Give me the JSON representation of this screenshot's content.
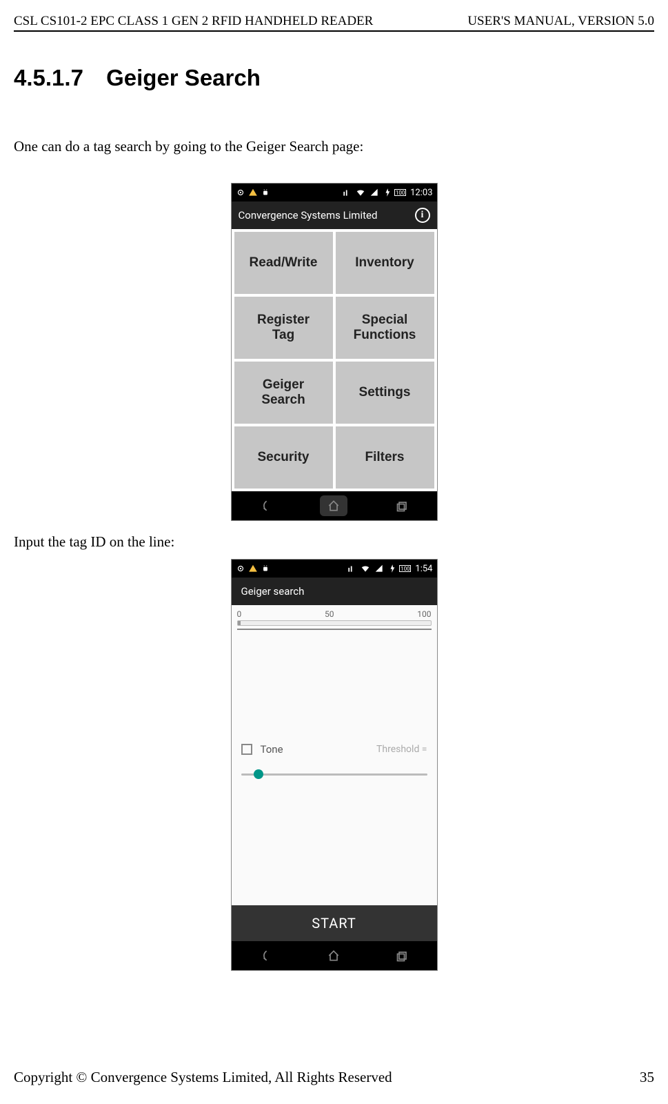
{
  "header": {
    "left": "CSL CS101-2 EPC CLASS 1 GEN 2 RFID HANDHELD READER",
    "right": "USER'S  MANUAL,   VERSION  5.0"
  },
  "section": {
    "number": "4.5.1.7",
    "title": "Geiger Search"
  },
  "paragraph1": "One can do a tag search by going to the Geiger Search page:",
  "paragraph2": "Input the tag ID on the line:",
  "screenshot1": {
    "statusbar": {
      "battery": "100",
      "time": "12:03"
    },
    "appbar": {
      "title": "Convergence Systems Limited",
      "info_glyph": "i"
    },
    "menu": [
      "Read/Write",
      "Inventory",
      "Register\nTag",
      "Special\nFunctions",
      "Geiger\nSearch",
      "Settings",
      "Security",
      "Filters"
    ]
  },
  "screenshot2": {
    "statusbar": {
      "battery": "100",
      "time": "1:54"
    },
    "appbar": {
      "title": "Geiger search"
    },
    "scale": {
      "min": "0",
      "mid": "50",
      "max": "100"
    },
    "tone_label": "Tone",
    "threshold_label": "Threshold =",
    "start": "START"
  },
  "footer": {
    "copyright": "Copyright © Convergence Systems Limited, All Rights Reserved",
    "page": "35"
  }
}
